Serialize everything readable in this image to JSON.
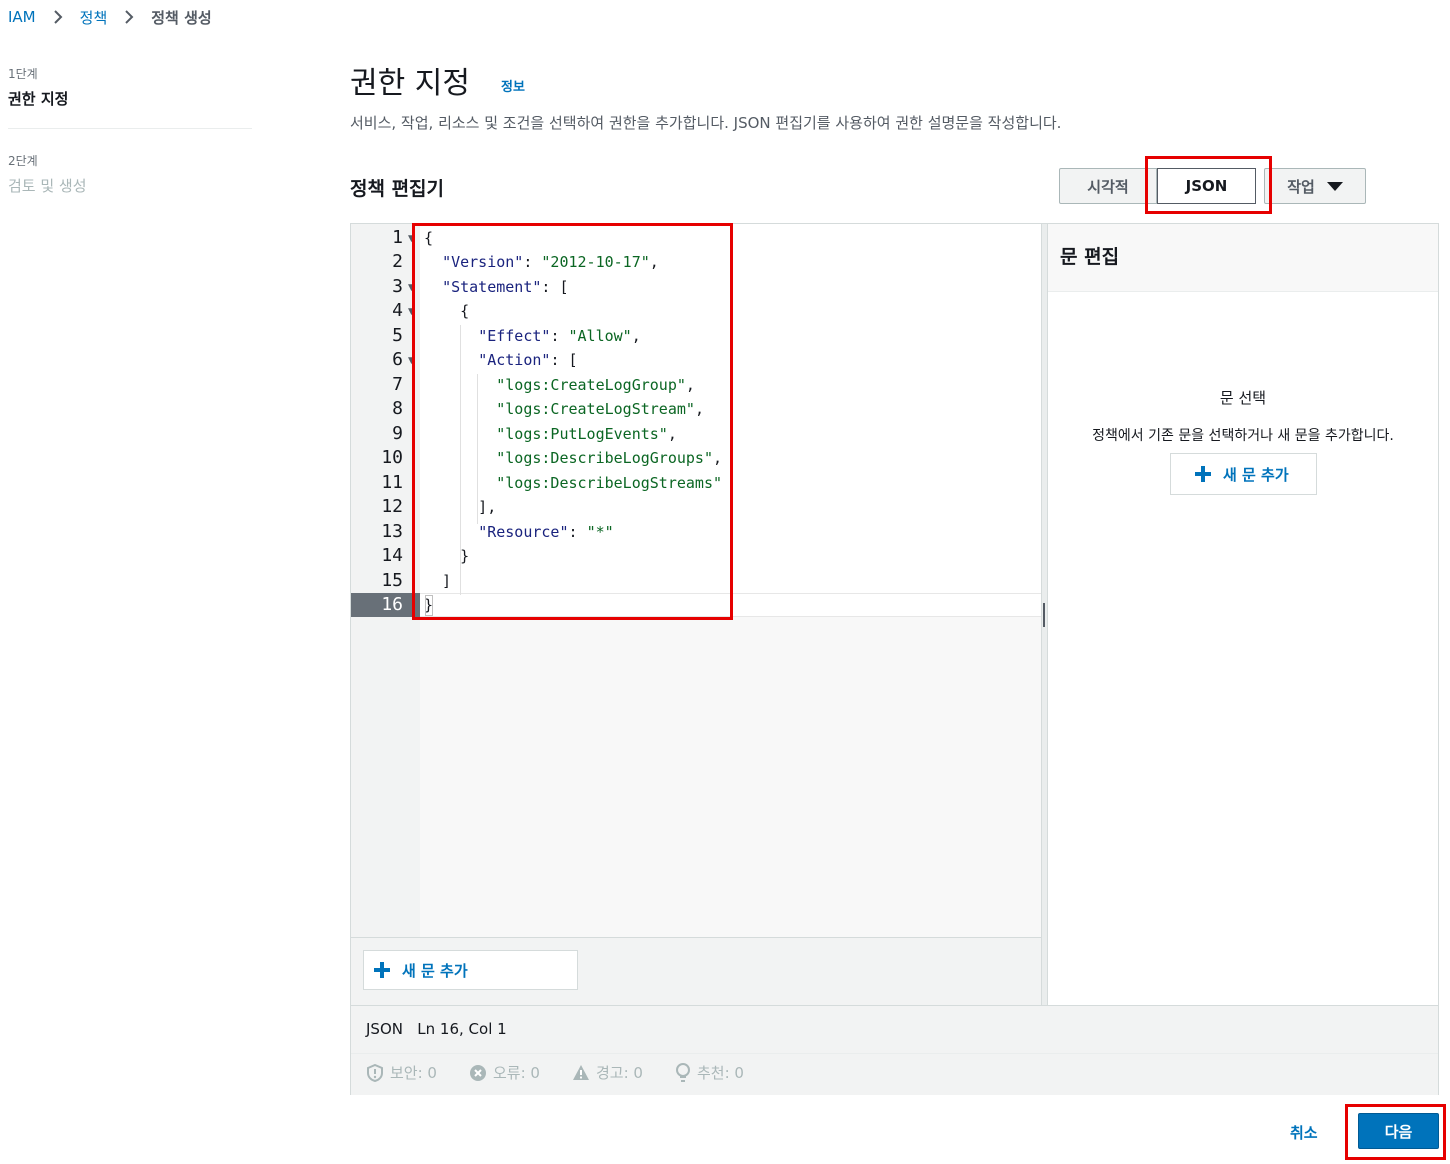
{
  "breadcrumb": {
    "root": "IAM",
    "policies": "정책",
    "current": "정책 생성"
  },
  "steps": [
    {
      "number": "1단계",
      "title": "권한 지정"
    },
    {
      "number": "2단계",
      "title": "검토 및 생성"
    }
  ],
  "header": {
    "title": "권한 지정",
    "info": "정보",
    "description": "서비스, 작업, 리소스 및 조건을 선택하여 권한을 추가합니다. JSON 편집기를 사용하여 권한 설명문을 작성합니다."
  },
  "editor": {
    "title": "정책 편집기",
    "modes": {
      "visual": "시각적",
      "json": "JSON",
      "actions": "작업"
    },
    "add_statement": "새 문 추가",
    "status_lang": "JSON",
    "status_pos": "Ln 16, Col 1",
    "metrics": {
      "security": "보안: 0",
      "errors": "오류: 0",
      "warnings": "경고: 0",
      "suggestions": "추천: 0"
    },
    "code": {
      "version_key": "\"Version\"",
      "version_val": "\"2012-10-17\"",
      "statement_key": "\"Statement\"",
      "effect_key": "\"Effect\"",
      "effect_val": "\"Allow\"",
      "action_key": "\"Action\"",
      "actions": [
        "\"logs:CreateLogGroup\"",
        "\"logs:CreateLogStream\"",
        "\"logs:PutLogEvents\"",
        "\"logs:DescribeLogGroups\"",
        "\"logs:DescribeLogStreams\""
      ],
      "resource_key": "\"Resource\"",
      "resource_val": "\"*\""
    },
    "line_numbers": [
      "1",
      "2",
      "3",
      "4",
      "5",
      "6",
      "7",
      "8",
      "9",
      "10",
      "11",
      "12",
      "13",
      "14",
      "15",
      "16"
    ]
  },
  "right_panel": {
    "title": "문 편집",
    "select_title": "문 선택",
    "select_desc": "정책에서 기존 문을 선택하거나 새 문을 추가합니다.",
    "add_statement": "새 문 추가"
  },
  "footer": {
    "cancel": "취소",
    "next": "다음"
  },
  "colors": {
    "accent": "#0073bb",
    "highlight": "#e60000"
  }
}
